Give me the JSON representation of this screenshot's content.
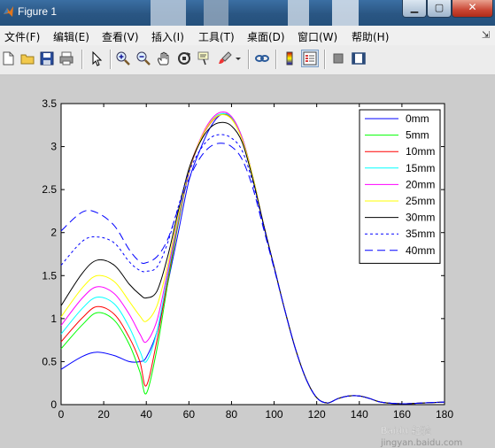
{
  "window": {
    "title": "Figure 1"
  },
  "menus": [
    "文件(F)",
    "编辑(E)",
    "查看(V)",
    "插入(I)",
    "工具(T)",
    "桌面(D)",
    "窗口(W)",
    "帮助(H)"
  ],
  "toolbar_icons": [
    "new-figure-icon",
    "open-icon",
    "save-icon",
    "print-icon",
    "pointer-icon",
    "zoom-in-icon",
    "zoom-out-icon",
    "pan-icon",
    "rotate-icon",
    "data-cursor-icon",
    "brush-icon",
    "link-icon",
    "colorbar-icon",
    "legend-icon",
    "hide-plot-tools-icon",
    "show-plot-tools-icon"
  ],
  "watermark": {
    "line1": "Baidu 经验",
    "line2": "jingyan.baidu.com"
  },
  "chart_data": {
    "type": "line",
    "title": "",
    "xlabel": "",
    "ylabel": "",
    "xlim": [
      0,
      180
    ],
    "ylim": [
      0,
      3.5
    ],
    "xticks": [
      "0",
      "20",
      "40",
      "60",
      "80",
      "100",
      "120",
      "140",
      "160",
      "180"
    ],
    "yticks": [
      "0",
      "0.5",
      "1",
      "1.5",
      "2",
      "2.5",
      "3",
      "3.5"
    ],
    "legend_position": "top-right",
    "x": [
      0,
      10,
      17,
      25,
      32,
      37,
      40,
      45,
      50,
      55,
      60,
      65,
      70,
      75,
      80,
      85,
      90,
      95,
      100,
      105,
      110,
      115,
      120,
      125,
      130,
      135,
      140,
      145,
      150,
      160,
      170,
      180
    ],
    "series": [
      {
        "name": "0mm",
        "color": "#0000ff",
        "dash": "solid",
        "values": [
          0.41,
          0.56,
          0.61,
          0.57,
          0.5,
          0.5,
          0.55,
          0.85,
          1.4,
          2.0,
          2.6,
          2.95,
          3.22,
          3.37,
          3.34,
          3.1,
          2.65,
          2.1,
          1.6,
          1.1,
          0.65,
          0.3,
          0.08,
          0.02,
          0.07,
          0.1,
          0.1,
          0.07,
          0.03,
          0.01,
          0.02,
          0.03
        ]
      },
      {
        "name": "5mm",
        "color": "#00ff00",
        "dash": "solid",
        "values": [
          0.65,
          0.93,
          1.07,
          0.98,
          0.7,
          0.38,
          0.13,
          0.65,
          1.4,
          2.1,
          2.7,
          3.05,
          3.28,
          3.38,
          3.33,
          3.1,
          2.65,
          2.1,
          1.6,
          1.1,
          0.65,
          0.3,
          0.08,
          0.02,
          0.07,
          0.1,
          0.1,
          0.07,
          0.03,
          0.01,
          0.02,
          0.03
        ]
      },
      {
        "name": "10mm",
        "color": "#ff0000",
        "dash": "solid",
        "values": [
          0.73,
          1.01,
          1.14,
          1.05,
          0.78,
          0.5,
          0.22,
          0.75,
          1.45,
          2.12,
          2.7,
          3.05,
          3.27,
          3.37,
          3.33,
          3.1,
          2.65,
          2.1,
          1.6,
          1.1,
          0.65,
          0.3,
          0.08,
          0.02,
          0.07,
          0.1,
          0.1,
          0.07,
          0.03,
          0.01,
          0.02,
          0.03
        ]
      },
      {
        "name": "15mm",
        "color": "#00ffff",
        "dash": "solid",
        "values": [
          0.82,
          1.12,
          1.25,
          1.17,
          0.9,
          0.62,
          0.5,
          0.85,
          1.5,
          2.15,
          2.72,
          3.06,
          3.28,
          3.38,
          3.34,
          3.1,
          2.65,
          2.1,
          1.6,
          1.1,
          0.65,
          0.3,
          0.08,
          0.02,
          0.07,
          0.1,
          0.1,
          0.07,
          0.03,
          0.01,
          0.02,
          0.03
        ]
      },
      {
        "name": "20mm",
        "color": "#ff00ff",
        "dash": "solid",
        "values": [
          0.92,
          1.24,
          1.37,
          1.29,
          1.05,
          0.82,
          0.73,
          0.98,
          1.55,
          2.18,
          2.73,
          3.07,
          3.3,
          3.4,
          3.35,
          3.1,
          2.65,
          2.1,
          1.6,
          1.1,
          0.65,
          0.3,
          0.08,
          0.02,
          0.07,
          0.1,
          0.1,
          0.07,
          0.03,
          0.01,
          0.02,
          0.03
        ]
      },
      {
        "name": "25mm",
        "color": "#ffff00",
        "dash": "solid",
        "values": [
          1.02,
          1.36,
          1.5,
          1.43,
          1.2,
          1.03,
          0.97,
          1.15,
          1.62,
          2.2,
          2.73,
          3.06,
          3.28,
          3.37,
          3.32,
          3.08,
          2.65,
          2.1,
          1.6,
          1.1,
          0.65,
          0.3,
          0.08,
          0.02,
          0.07,
          0.1,
          0.1,
          0.07,
          0.03,
          0.01,
          0.02,
          0.03
        ]
      },
      {
        "name": "30mm",
        "color": "#000000",
        "dash": "solid",
        "values": [
          1.15,
          1.53,
          1.68,
          1.62,
          1.4,
          1.28,
          1.24,
          1.32,
          1.72,
          2.25,
          2.74,
          3.04,
          3.22,
          3.28,
          3.24,
          3.05,
          2.62,
          2.1,
          1.6,
          1.1,
          0.65,
          0.3,
          0.08,
          0.02,
          0.07,
          0.1,
          0.1,
          0.07,
          0.03,
          0.01,
          0.02,
          0.03
        ]
      },
      {
        "name": "35mm",
        "color": "#0000ff",
        "dash": "dotted",
        "values": [
          1.62,
          1.9,
          1.95,
          1.88,
          1.66,
          1.56,
          1.55,
          1.6,
          1.88,
          2.3,
          2.7,
          2.95,
          3.1,
          3.14,
          3.1,
          2.95,
          2.58,
          2.08,
          1.6,
          1.1,
          0.65,
          0.3,
          0.08,
          0.02,
          0.07,
          0.1,
          0.1,
          0.07,
          0.03,
          0.01,
          0.02,
          0.03
        ]
      },
      {
        "name": "40mm",
        "color": "#0000ff",
        "dash": "dashed",
        "values": [
          2.02,
          2.24,
          2.23,
          2.08,
          1.8,
          1.66,
          1.65,
          1.72,
          1.92,
          2.28,
          2.62,
          2.86,
          3.0,
          3.04,
          3.0,
          2.85,
          2.52,
          2.05,
          1.58,
          1.1,
          0.65,
          0.3,
          0.08,
          0.02,
          0.07,
          0.1,
          0.1,
          0.07,
          0.03,
          0.01,
          0.02,
          0.03
        ]
      }
    ]
  }
}
